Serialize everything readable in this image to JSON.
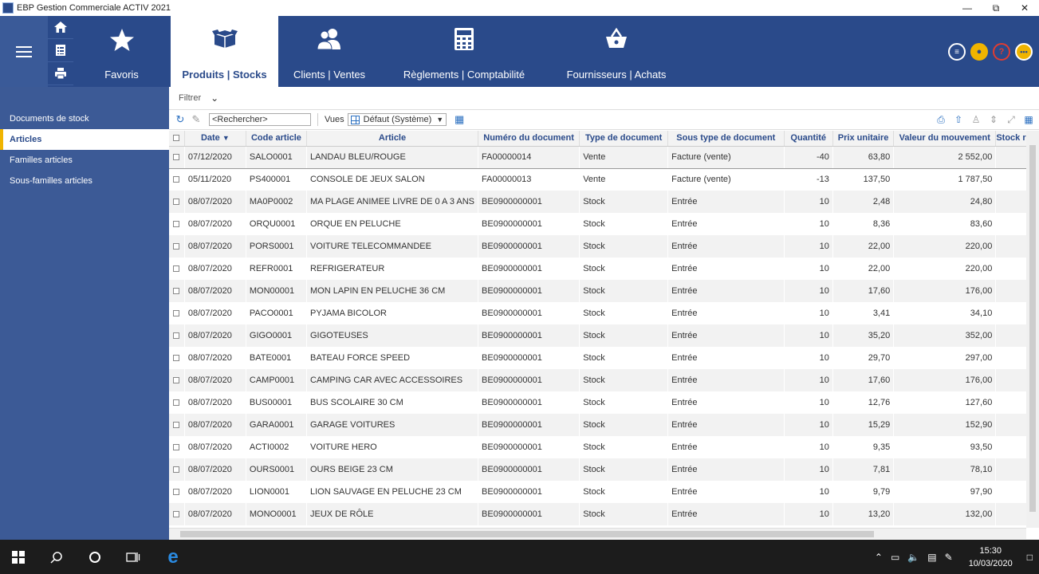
{
  "window": {
    "title": "EBP Gestion Commerciale ACTIV 2021",
    "controls": [
      "minimize-icon",
      "restore-icon",
      "close-icon"
    ]
  },
  "topnav": {
    "quick_icons": [
      "home-icon",
      "document-list-icon",
      "printer-icon"
    ],
    "tabs": [
      {
        "label": "Favoris",
        "icon": "star-icon",
        "active": false
      },
      {
        "label": "Produits | Stocks",
        "icon": "box-icon",
        "active": true
      },
      {
        "label": "Clients | Ventes",
        "icon": "users-icon",
        "active": false
      },
      {
        "label": "Règlements | Comptabilité",
        "icon": "calculator-icon",
        "active": false
      },
      {
        "label": "Fournisseurs | Achats",
        "icon": "basket-icon",
        "active": false
      }
    ],
    "right_icons": [
      "menu-circle-icon",
      "bell-icon",
      "help-icon",
      "more-icon"
    ]
  },
  "sidebar": {
    "items": [
      {
        "label": "Documents de stock",
        "active": false
      },
      {
        "label": "Articles",
        "active": true
      },
      {
        "label": "Familles articles",
        "active": false
      },
      {
        "label": "Sous-familles articles",
        "active": false
      }
    ]
  },
  "filterbar": {
    "label": "Filtrer"
  },
  "toolbar": {
    "search_placeholder": "<Rechercher>",
    "views_label": "Vues",
    "view_selected": "Défaut (Système)"
  },
  "table": {
    "columns": [
      "",
      "Date",
      "Code article",
      "Article",
      "Numéro du document",
      "Type de document",
      "Sous type de document",
      "Quantité",
      "Prix unitaire",
      "Valeur du mouvement",
      "Stock réel"
    ],
    "rows": [
      [
        "07/12/2020",
        "SALO0001",
        "LANDAU BLEU/ROUGE",
        "FA00000014",
        "Vente",
        "Facture (vente)",
        "-40",
        "63,80",
        "2 552,00"
      ],
      [
        "05/11/2020",
        "PS400001",
        "CONSOLE DE JEUX SALON",
        "FA00000013",
        "Vente",
        "Facture (vente)",
        "-13",
        "137,50",
        "1 787,50"
      ],
      [
        "08/07/2020",
        "MA0P0002",
        "MA PLAGE ANIMEE LIVRE DE 0 A 3 ANS",
        "BE0900000001",
        "Stock",
        "Entrée",
        "10",
        "2,48",
        "24,80"
      ],
      [
        "08/07/2020",
        "ORQU0001",
        "ORQUE EN PELUCHE",
        "BE0900000001",
        "Stock",
        "Entrée",
        "10",
        "8,36",
        "83,60"
      ],
      [
        "08/07/2020",
        "PORS0001",
        "VOITURE TELECOMMANDEE",
        "BE0900000001",
        "Stock",
        "Entrée",
        "10",
        "22,00",
        "220,00"
      ],
      [
        "08/07/2020",
        "REFR0001",
        "REFRIGERATEUR",
        "BE0900000001",
        "Stock",
        "Entrée",
        "10",
        "22,00",
        "220,00"
      ],
      [
        "08/07/2020",
        "MON00001",
        "MON LAPIN EN PELUCHE 36 CM",
        "BE0900000001",
        "Stock",
        "Entrée",
        "10",
        "17,60",
        "176,00"
      ],
      [
        "08/07/2020",
        "PACO0001",
        "PYJAMA BICOLOR",
        "BE0900000001",
        "Stock",
        "Entrée",
        "10",
        "3,41",
        "34,10"
      ],
      [
        "08/07/2020",
        "GIGO0001",
        "GIGOTEUSES",
        "BE0900000001",
        "Stock",
        "Entrée",
        "10",
        "35,20",
        "352,00"
      ],
      [
        "08/07/2020",
        "BATE0001",
        "BATEAU FORCE SPEED",
        "BE0900000001",
        "Stock",
        "Entrée",
        "10",
        "29,70",
        "297,00"
      ],
      [
        "08/07/2020",
        "CAMP0001",
        "CAMPING CAR AVEC ACCESSOIRES",
        "BE0900000001",
        "Stock",
        "Entrée",
        "10",
        "17,60",
        "176,00"
      ],
      [
        "08/07/2020",
        "BUS00001",
        "BUS SCOLAIRE 30 CM",
        "BE0900000001",
        "Stock",
        "Entrée",
        "10",
        "12,76",
        "127,60"
      ],
      [
        "08/07/2020",
        "GARA0001",
        "GARAGE VOITURES",
        "BE0900000001",
        "Stock",
        "Entrée",
        "10",
        "15,29",
        "152,90"
      ],
      [
        "08/07/2020",
        "ACTI0002",
        "VOITURE HERO",
        "BE0900000001",
        "Stock",
        "Entrée",
        "10",
        "9,35",
        "93,50"
      ],
      [
        "08/07/2020",
        "OURS0001",
        "OURS BEIGE 23 CM",
        "BE0900000001",
        "Stock",
        "Entrée",
        "10",
        "7,81",
        "78,10"
      ],
      [
        "08/07/2020",
        "LION0001",
        "LION SAUVAGE EN PELUCHE 23 CM",
        "BE0900000001",
        "Stock",
        "Entrée",
        "10",
        "9,79",
        "97,90"
      ],
      [
        "08/07/2020",
        "MONO0001",
        "JEUX DE RÔLE",
        "BE0900000001",
        "Stock",
        "Entrée",
        "10",
        "13,20",
        "132,00"
      ]
    ]
  },
  "taskbar": {
    "time": "15:30",
    "date": "10/03/2020"
  }
}
